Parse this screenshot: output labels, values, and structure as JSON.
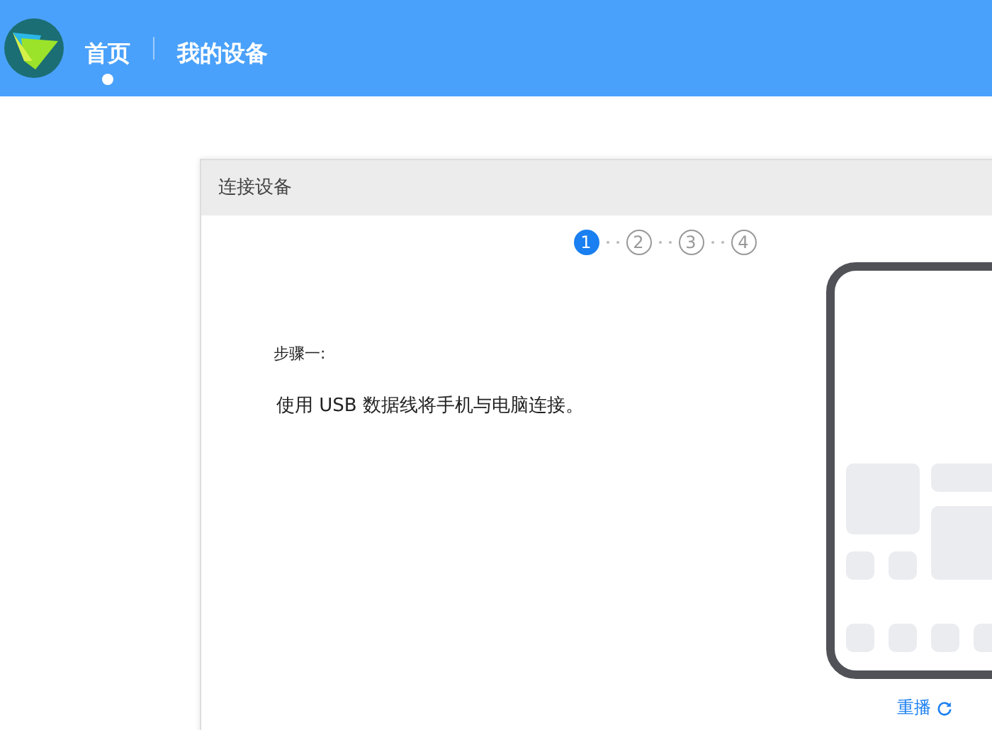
{
  "nav": {
    "tabs": [
      {
        "label": "首页",
        "selected": true
      },
      {
        "label": "我的设备",
        "selected": false
      }
    ]
  },
  "dialog": {
    "title": "连接设备",
    "steps": [
      {
        "label": "1",
        "selected": true
      },
      {
        "label": "2",
        "selected": false
      },
      {
        "label": "3",
        "selected": false
      },
      {
        "label": "4",
        "selected": false
      }
    ],
    "step_title": "步骤一:",
    "instruction": "使用 USB 数据线将手机与电脑连接。",
    "replay": "重播"
  }
}
